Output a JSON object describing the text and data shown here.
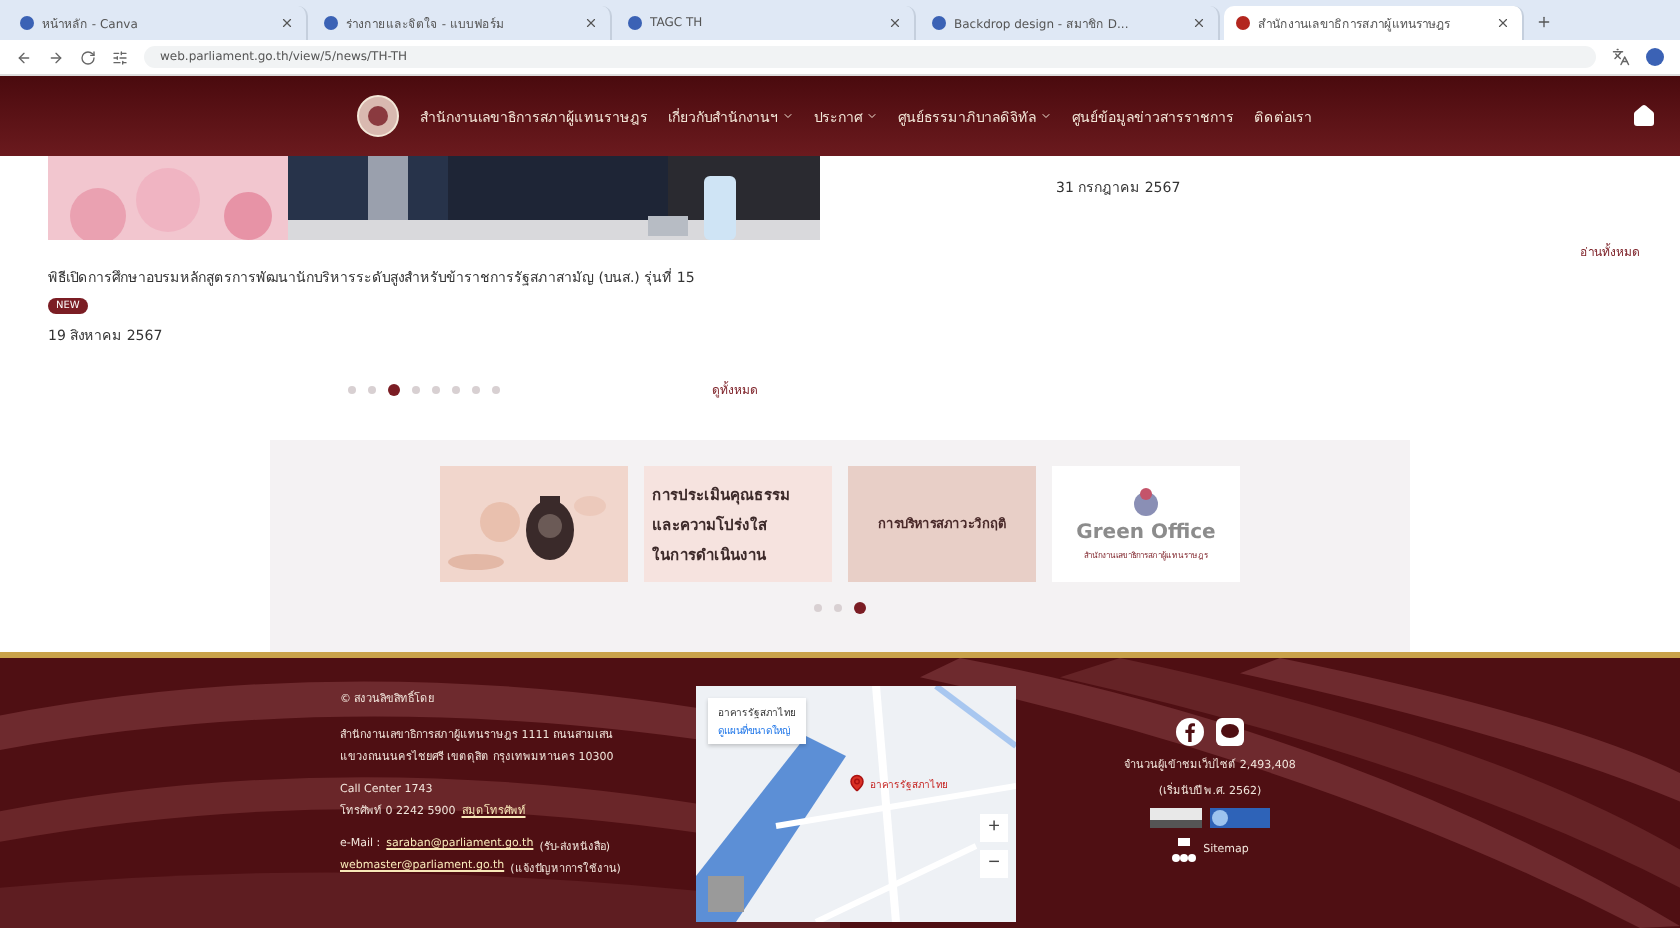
{
  "browser": {
    "tabs": [
      {
        "title": "หน้าหลัก - Canva",
        "selected": false
      },
      {
        "title": "ร่างกายและจิตใจ - แบบฟอร์ม",
        "selected": false
      },
      {
        "title": "TAGC TH",
        "selected": false
      },
      {
        "title": "Backdrop design - สมาชิก D...",
        "selected": false
      },
      {
        "title": "สำนักงานเลขาธิการสภาผู้แทนราษฎร",
        "selected": true
      }
    ],
    "url": "web.parliament.go.th/view/5/news/TH-TH"
  },
  "nav": {
    "title": "สำนักงานเลขาธิการสภาผู้แทนราษฎร",
    "items": [
      {
        "label": "เกี่ยวกับสำนักงานฯ",
        "dropdown": true
      },
      {
        "label": "ประกาศ",
        "dropdown": true
      },
      {
        "label": "ศูนย์ธรรมาภิบาลดิจิทัล",
        "dropdown": true
      },
      {
        "label": "ศูนย์ข้อมูลข่าวสารราชการ",
        "dropdown": false
      },
      {
        "label": "ติดต่อเรา",
        "dropdown": false
      }
    ]
  },
  "news": {
    "caption": "พิธีเปิดการศึกษาอบรมหลักสูตรการพัฒนานักบริหารระดับสูงสำหรับข้าราชการรัฐสภาสามัญ (บนส.) รุ่นที่ 15",
    "badge": "NEW",
    "date": "19 สิงหาคม 2567",
    "side_date": "31 กรกฎาคม 2567",
    "read_all": "อ่านทั้งหมด",
    "view_all": "ดูทั้งหมด",
    "dots": [
      {
        "selected": false
      },
      {
        "selected": false
      },
      {
        "selected": true
      },
      {
        "selected": false
      },
      {
        "selected": false
      },
      {
        "selected": false
      },
      {
        "selected": false
      },
      {
        "selected": false
      }
    ]
  },
  "banners": {
    "items": [
      {
        "kind": "picture"
      },
      {
        "kind": "integrity",
        "lines": [
          "การประเมินคุณธรรม",
          "และความโปร่งใส",
          "ในการดำเนินงาน"
        ]
      },
      {
        "kind": "crisis",
        "lines": [
          "การบริหารสภาวะวิกฤติ"
        ]
      },
      {
        "kind": "logo",
        "lines": [
          "Green Office",
          "สำนักงานเลขาธิการสภาผู้แทนราษฎร"
        ]
      }
    ],
    "dots": [
      {
        "selected": false
      },
      {
        "selected": false
      },
      {
        "selected": true
      }
    ]
  },
  "footer": {
    "copyright": "© สงวนลิขสิทธิ์โดย",
    "address": [
      "สำนักงานเลขาธิการสภาผู้แทนราษฎร 1111 ถนนสามเสน",
      "แขวงถนนนครไชยศรี เขตดุสิต กรุงเทพมหานคร 10300"
    ],
    "call_center": "Call Center 1743",
    "phone": "โทรศัพท์ 0 2242 5900",
    "phonebook": "สมุดโทรศัพท์",
    "emails": [
      {
        "label": "e-Mail :",
        "address": "saraban@parliament.go.th",
        "note": "(รับ-ส่งหนังสือ)"
      },
      {
        "address": "webmaster@parliament.go.th",
        "note": "(แจ้งปัญหาการใช้งาน)"
      }
    ],
    "map": {
      "place": "อาคารรัฐสภาไทย",
      "larger_map": "ดูแผนที่ขนาดใหญ่",
      "marker": "อาคารรัฐสภาไทย",
      "zoom_in": "+",
      "zoom_out": "−"
    },
    "visitors": "จำนวนผู้เข้าชมเว็บไซต์ 2,493,408",
    "since": "(เริ่มนับปี พ.ศ. 2562)",
    "sitemap": "Sitemap"
  }
}
